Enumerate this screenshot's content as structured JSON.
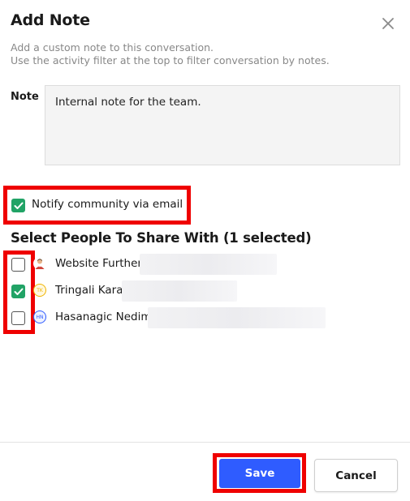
{
  "modal": {
    "title": "Add Note",
    "close_icon": "close-icon",
    "description_line1": "Add a custom note to this conversation.",
    "description_line2": "Use the activity filter at the top to filter conversation by notes."
  },
  "note": {
    "label": "Note",
    "value": "Internal note for the team."
  },
  "notify": {
    "label": "Notify community via email",
    "checked": true
  },
  "share": {
    "title": "Select People To Share With (1 selected)",
    "people": [
      {
        "name": "Website Further",
        "checked": false,
        "avatar_icon": "user-photo-avatar"
      },
      {
        "name": "Tringali Kara",
        "checked": true,
        "avatar_initials": "TK",
        "avatar_color": "#f0b400"
      },
      {
        "name": "Hasanagic Nedim",
        "checked": false,
        "avatar_initials": "HN",
        "avatar_color": "#2f5cff"
      }
    ]
  },
  "footer": {
    "save_label": "Save",
    "cancel_label": "Cancel"
  },
  "colors": {
    "accent": "#2f5cff",
    "check": "#21a366",
    "highlight": "#ef0000"
  }
}
